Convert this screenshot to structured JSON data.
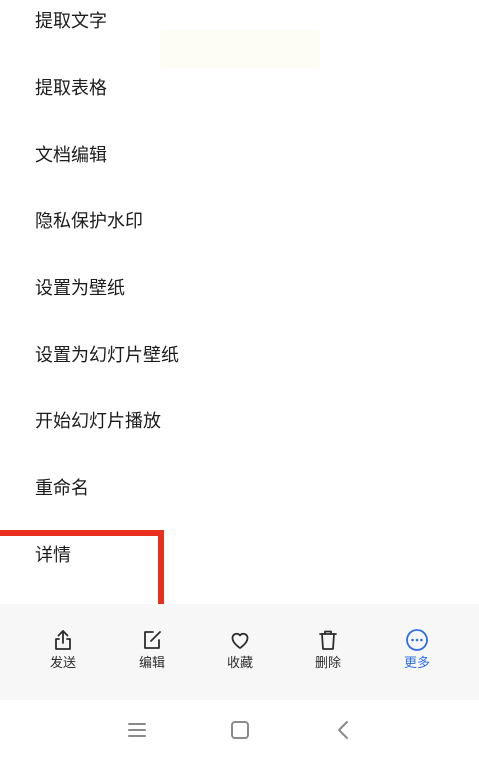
{
  "menu": {
    "items": [
      {
        "label": "提取文字"
      },
      {
        "label": "提取表格"
      },
      {
        "label": "文档编辑"
      },
      {
        "label": "隐私保护水印"
      },
      {
        "label": "设置为壁纸"
      },
      {
        "label": "设置为幻灯片壁纸"
      },
      {
        "label": "开始幻灯片播放"
      },
      {
        "label": "重命名"
      },
      {
        "label": "详情"
      }
    ]
  },
  "toolbar": {
    "items": [
      {
        "label": "发送",
        "icon": "share-icon"
      },
      {
        "label": "编辑",
        "icon": "edit-icon"
      },
      {
        "label": "收藏",
        "icon": "heart-icon"
      },
      {
        "label": "删除",
        "icon": "trash-icon"
      },
      {
        "label": "更多",
        "icon": "more-icon",
        "active": true
      }
    ]
  },
  "navbar": {
    "items": [
      "menu-icon",
      "home-icon",
      "back-icon"
    ]
  },
  "colors": {
    "highlight": "#e8301d",
    "accent": "#2f6fe6",
    "toolbar_bg": "#f7f7f7"
  }
}
